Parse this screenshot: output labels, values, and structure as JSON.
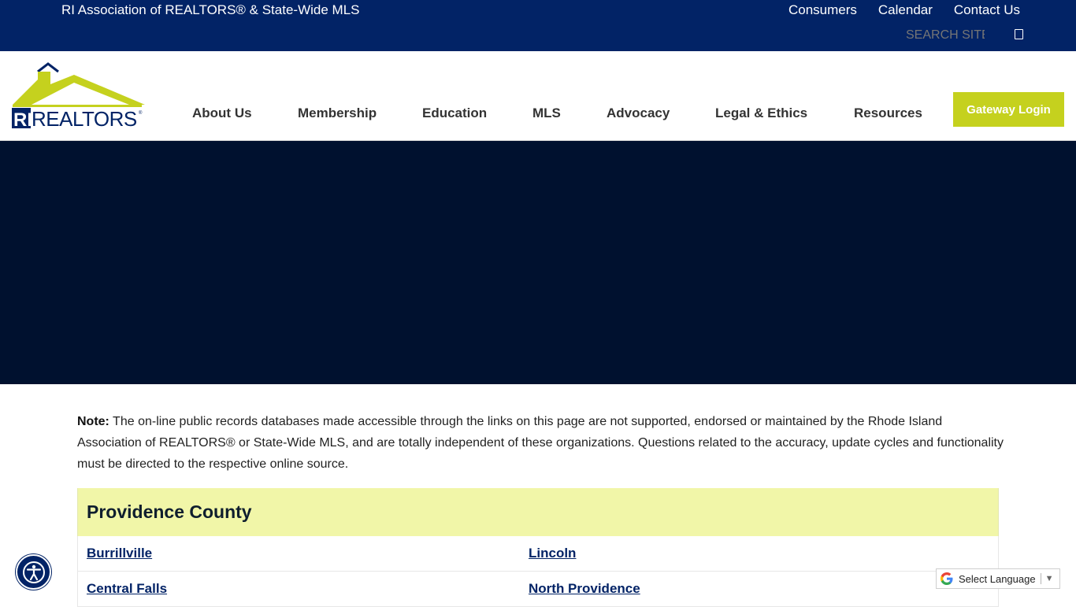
{
  "topbar": {
    "org_name": "RI Association of REALTORS® & State-Wide MLS",
    "links": [
      "Consumers",
      "Calendar",
      "Contact Us"
    ],
    "search_placeholder": "SEARCH SITE"
  },
  "header": {
    "logo_text": "RIREALTORS",
    "nav": [
      "About Us",
      "Membership",
      "Education",
      "MLS",
      "Advocacy",
      "Legal & Ethics",
      "Resources"
    ],
    "gateway_label": "Gateway Login"
  },
  "note": {
    "label": "Note:",
    "text": " The on-line public records databases made accessible through the links on this page are not supported, endorsed or maintained by the Rhode Island Association of REALTORS® or State-Wide MLS, and are totally independent of these organizations. Questions related to the accuracy, update cycles and functionality must be directed to the respective online source."
  },
  "county": {
    "title": "Providence County",
    "rows": [
      [
        "Burrillville",
        "Lincoln"
      ],
      [
        "Central Falls",
        "North Providence"
      ]
    ]
  },
  "translate": {
    "label": "Select Language",
    "arrow": "▼"
  },
  "colors": {
    "navy": "#022366",
    "hero": "#00112f",
    "accent_green": "#c5d11e",
    "county_header_bg": "#f1f6a8"
  },
  "icons": [
    "search-icon",
    "accessibility-icon",
    "google-icon",
    "house-roof-logo"
  ]
}
